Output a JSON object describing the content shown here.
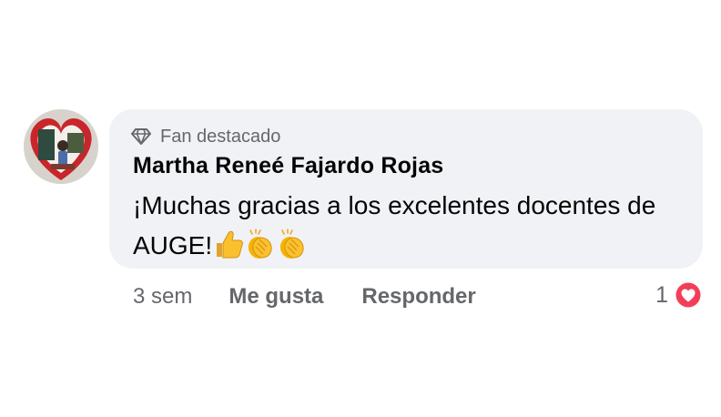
{
  "comment": {
    "badge": {
      "icon": "diamond-icon",
      "label": "Fan destacado"
    },
    "author": "Martha Reneé Fajardo Rojas",
    "text": "¡Muchas gracias a los excelentes docentes de AUGE!",
    "emojis": [
      "thumbs-up-icon",
      "clapping-hands-icon",
      "clapping-hands-icon"
    ],
    "time": "3 sem",
    "like_label": "Me gusta",
    "reply_label": "Responder",
    "reaction_count": "1",
    "reaction_icon": "heart-reaction-icon"
  },
  "colors": {
    "bubble": "#f0f2f5",
    "secondary_text": "#65676b",
    "primary_text": "#050505",
    "heart": "#f33e58",
    "emoji_yellow": "#fbc02d"
  }
}
